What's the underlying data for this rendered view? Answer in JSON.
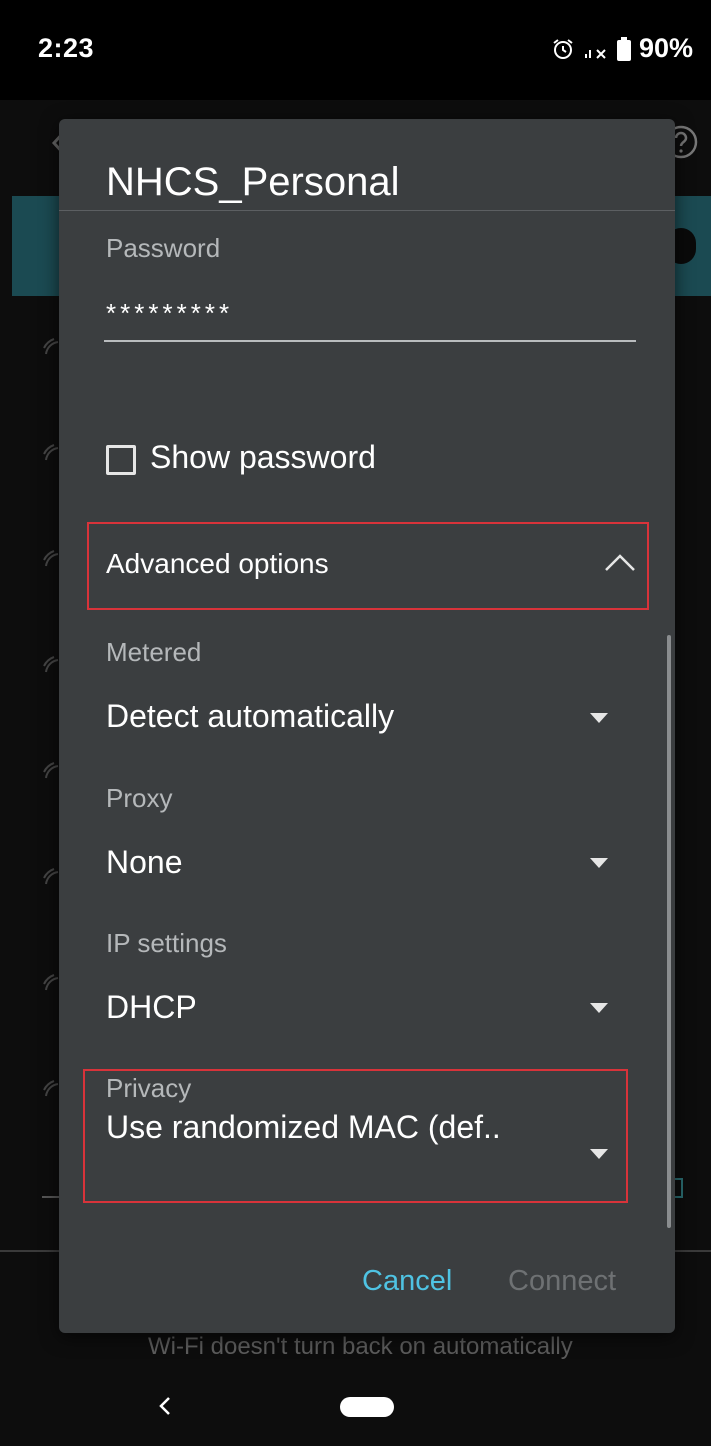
{
  "status_bar": {
    "time": "2:23",
    "battery_percent": "90%",
    "icons": [
      "alarm-icon",
      "signal-no-data-icon",
      "battery-icon"
    ]
  },
  "background": {
    "footer_text": "Wi-Fi doesn't turn back on automatically",
    "icons": [
      "back-arrow-icon",
      "help-icon",
      "wifi-icon"
    ]
  },
  "dialog": {
    "title": "NHCS_Personal",
    "password": {
      "label": "Password",
      "value": "*********"
    },
    "show_password": {
      "label": "Show password",
      "checked": false
    },
    "advanced_options": {
      "label": "Advanced options",
      "expanded": true,
      "icon": "chevron-up-icon"
    },
    "metered": {
      "label": "Metered",
      "value": "Detect automatically"
    },
    "proxy": {
      "label": "Proxy",
      "value": "None"
    },
    "ip_settings": {
      "label": "IP settings",
      "value": "DHCP"
    },
    "privacy": {
      "label": "Privacy",
      "value": "Use randomized MAC (def.."
    },
    "buttons": {
      "cancel": "Cancel",
      "connect": "Connect"
    }
  },
  "colors": {
    "dialog_bg": "#3b3e40",
    "accent": "#4fc3e3",
    "highlight": "#d8333a",
    "disabled_text": "#6e7173",
    "banner": "#1b4a52"
  }
}
